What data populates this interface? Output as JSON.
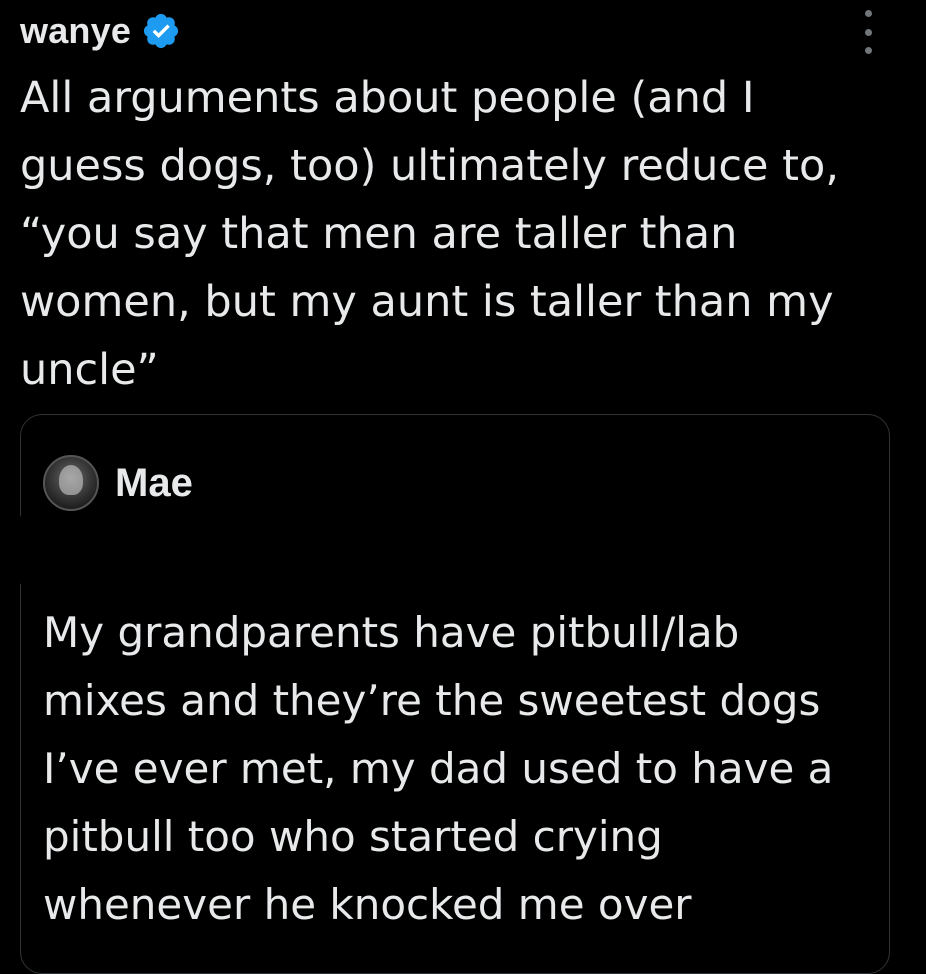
{
  "post": {
    "author": {
      "name": "wanye",
      "verified_icon": "verified-badge-icon"
    },
    "more_icon": "more-options-icon",
    "text": "All arguments about people (and I\nguess dogs, too) ultimately reduce to,\n“you say that men are taller than\nwomen, but my aunt is taller than my\nuncle”"
  },
  "quoted_post": {
    "author": {
      "name": "Mae",
      "avatar_icon": "avatar"
    },
    "text": "My grandparents have pitbull/lab\nmixes and they’re the sweetest dogs\nI’ve ever met, my dad used to have a\npitbull too who started crying\nwhenever he knocked me over"
  },
  "colors": {
    "background": "#000000",
    "text": "#e7e9ea",
    "muted": "#71767b",
    "border": "#2f3336",
    "verified": "#1d9bf0"
  }
}
